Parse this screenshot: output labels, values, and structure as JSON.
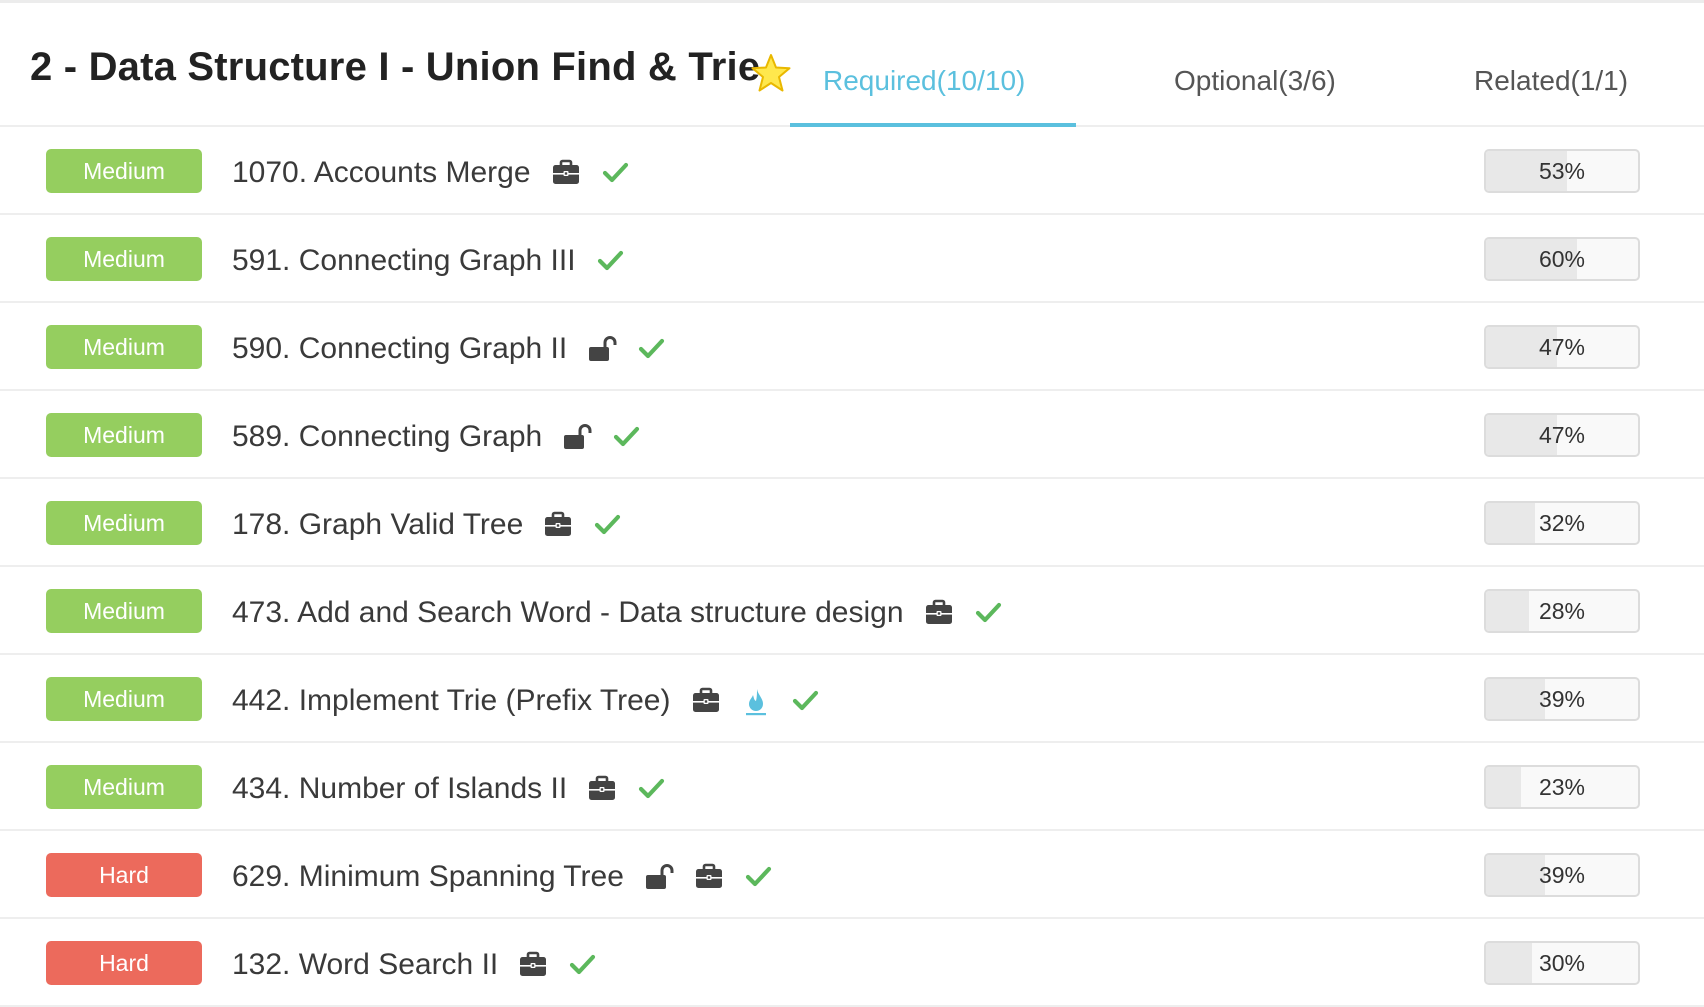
{
  "header": {
    "title": "2 - Data Structure I - Union Find & Trie",
    "star_icon": "star-icon",
    "tabs": [
      {
        "label": "Required(10/10)",
        "active": true
      },
      {
        "label": "Optional(3/6)",
        "active": false
      },
      {
        "label": "Related(1/1)",
        "active": false
      }
    ]
  },
  "colors": {
    "accent": "#5bc0de",
    "medium": "#95ce5f",
    "hard": "#ec6a5c",
    "check": "#5cb85c",
    "icon": "#444444",
    "flame": "#5bc0de"
  },
  "problems": [
    {
      "difficulty": "Medium",
      "title": "1070. Accounts Merge",
      "icons": [
        "briefcase-icon",
        "check-icon"
      ],
      "rate": "53%",
      "rate_value": 53
    },
    {
      "difficulty": "Medium",
      "title": "591. Connecting Graph III",
      "icons": [
        "check-icon"
      ],
      "rate": "60%",
      "rate_value": 60
    },
    {
      "difficulty": "Medium",
      "title": "590. Connecting Graph II",
      "icons": [
        "unlock-icon",
        "check-icon"
      ],
      "rate": "47%",
      "rate_value": 47
    },
    {
      "difficulty": "Medium",
      "title": "589. Connecting Graph",
      "icons": [
        "unlock-icon",
        "check-icon"
      ],
      "rate": "47%",
      "rate_value": 47
    },
    {
      "difficulty": "Medium",
      "title": "178. Graph Valid Tree",
      "icons": [
        "briefcase-icon",
        "check-icon"
      ],
      "rate": "32%",
      "rate_value": 32
    },
    {
      "difficulty": "Medium",
      "title": "473. Add and Search Word - Data structure design",
      "icons": [
        "briefcase-icon",
        "check-icon"
      ],
      "rate": "28%",
      "rate_value": 28
    },
    {
      "difficulty": "Medium",
      "title": "442. Implement Trie (Prefix Tree)",
      "icons": [
        "briefcase-icon",
        "flame-icon",
        "check-icon"
      ],
      "rate": "39%",
      "rate_value": 39
    },
    {
      "difficulty": "Medium",
      "title": "434. Number of Islands II",
      "icons": [
        "briefcase-icon",
        "check-icon"
      ],
      "rate": "23%",
      "rate_value": 23
    },
    {
      "difficulty": "Hard",
      "title": "629. Minimum Spanning Tree",
      "icons": [
        "unlock-icon",
        "briefcase-icon",
        "check-icon"
      ],
      "rate": "39%",
      "rate_value": 39
    },
    {
      "difficulty": "Hard",
      "title": "132. Word Search II",
      "icons": [
        "briefcase-icon",
        "check-icon"
      ],
      "rate": "30%",
      "rate_value": 30
    }
  ]
}
